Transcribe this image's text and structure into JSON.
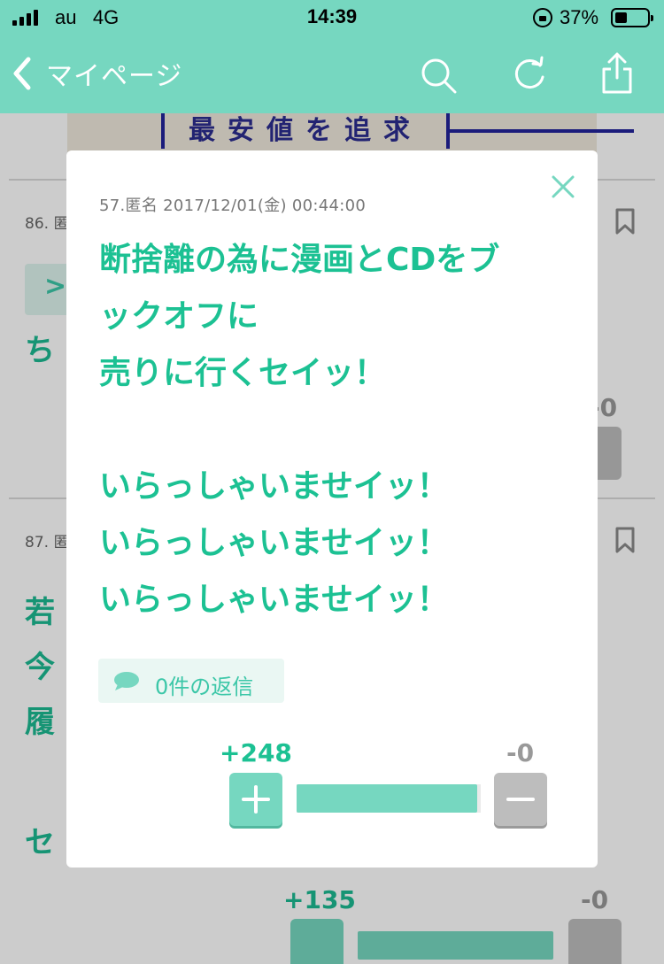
{
  "colors": {
    "accent": "#76d7c0",
    "text_green": "#1cc193",
    "minus_gray": "#bdbdbd"
  },
  "status_bar": {
    "carrier": "au",
    "network": "4G",
    "time": "14:39",
    "battery": "37%"
  },
  "nav": {
    "back_label": "マイページ",
    "icons": [
      "search-icon",
      "refresh-icon",
      "share-icon"
    ]
  },
  "background": {
    "ad_text": "最安値を追求",
    "post86": {
      "meta": "86. 匿",
      "quote": ">",
      "text": "ち",
      "minus": "-0"
    },
    "post87": {
      "meta": "87. 匿",
      "lines": [
        "若",
        "今",
        "履",
        "",
        "セ"
      ],
      "plus": "+135",
      "minus": "-0",
      "plus_share": 0.97
    }
  },
  "modal": {
    "meta": "57.匿名 2017/12/01(金) 00:44:00",
    "body_lines": [
      "断捨離の為に漫画とCDをブ",
      "ックオフに",
      "売りに行くセイッ！",
      "",
      "いらっしゃいませイッ！",
      "いらっしゃいませイッ！",
      "いらっしゃいませイッ！"
    ],
    "reply_label": "0件の返信",
    "plus_count": "+248",
    "minus_count": "-0",
    "plus_share": 0.98
  }
}
